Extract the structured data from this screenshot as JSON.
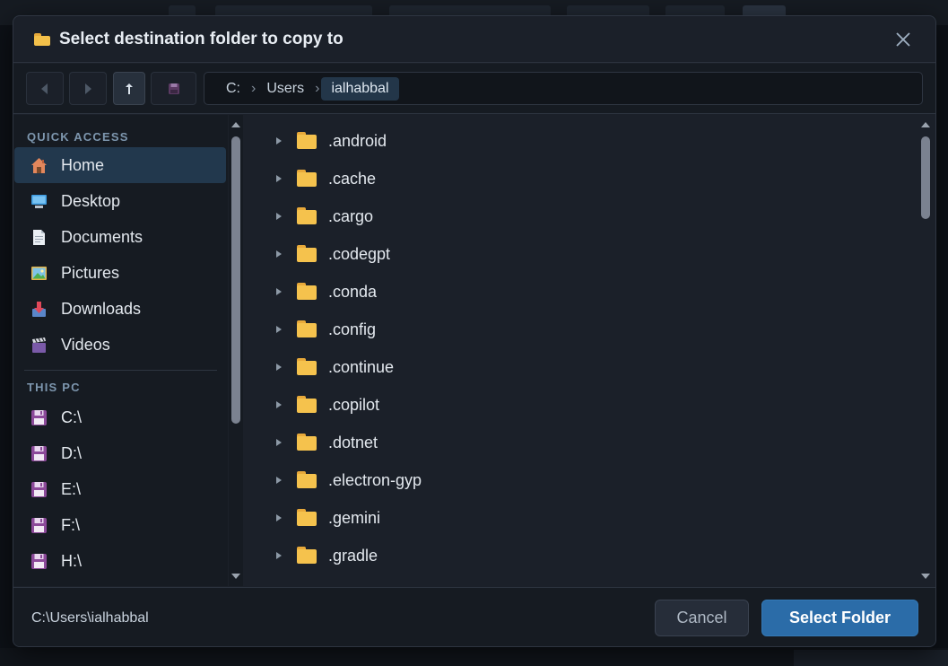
{
  "dialog": {
    "title": "Select destination folder to copy to",
    "title_icon": "folder-icon",
    "close_icon": "close-icon"
  },
  "toolbar": {
    "back_icon": "back-arrow-icon",
    "forward_icon": "forward-arrow-icon",
    "up_icon": "up-arrow-icon",
    "drive_icon": "floppy-drive-icon"
  },
  "breadcrumb": {
    "items": [
      "C:",
      "Users",
      "ialhabbal"
    ],
    "separator": "›"
  },
  "sidebar": {
    "quick_access_label": "QUICK ACCESS",
    "quick_access": [
      {
        "label": "Home",
        "icon": "home-icon",
        "selected": true
      },
      {
        "label": "Desktop",
        "icon": "desktop-icon"
      },
      {
        "label": "Documents",
        "icon": "document-icon"
      },
      {
        "label": "Pictures",
        "icon": "picture-icon"
      },
      {
        "label": "Downloads",
        "icon": "download-icon"
      },
      {
        "label": "Videos",
        "icon": "video-icon"
      }
    ],
    "this_pc_label": "THIS PC",
    "drives": [
      {
        "label": "C:\\",
        "icon": "floppy-drive-icon"
      },
      {
        "label": "D:\\",
        "icon": "floppy-drive-icon"
      },
      {
        "label": "E:\\",
        "icon": "floppy-drive-icon"
      },
      {
        "label": "F:\\",
        "icon": "floppy-drive-icon"
      },
      {
        "label": "H:\\",
        "icon": "floppy-drive-icon"
      }
    ]
  },
  "folders": [
    ".android",
    ".cache",
    ".cargo",
    ".codegpt",
    ".conda",
    ".config",
    ".continue",
    ".copilot",
    ".dotnet",
    ".electron-gyp",
    ".gemini",
    ".gradle"
  ],
  "footer": {
    "path": "C:\\Users\\ialhabbal",
    "cancel_label": "Cancel",
    "select_label": "Select Folder"
  },
  "colors": {
    "accent": "#2b6ca8",
    "folder": "#f5c24d",
    "selected_row": "#22384d",
    "background": "#1b2029"
  }
}
